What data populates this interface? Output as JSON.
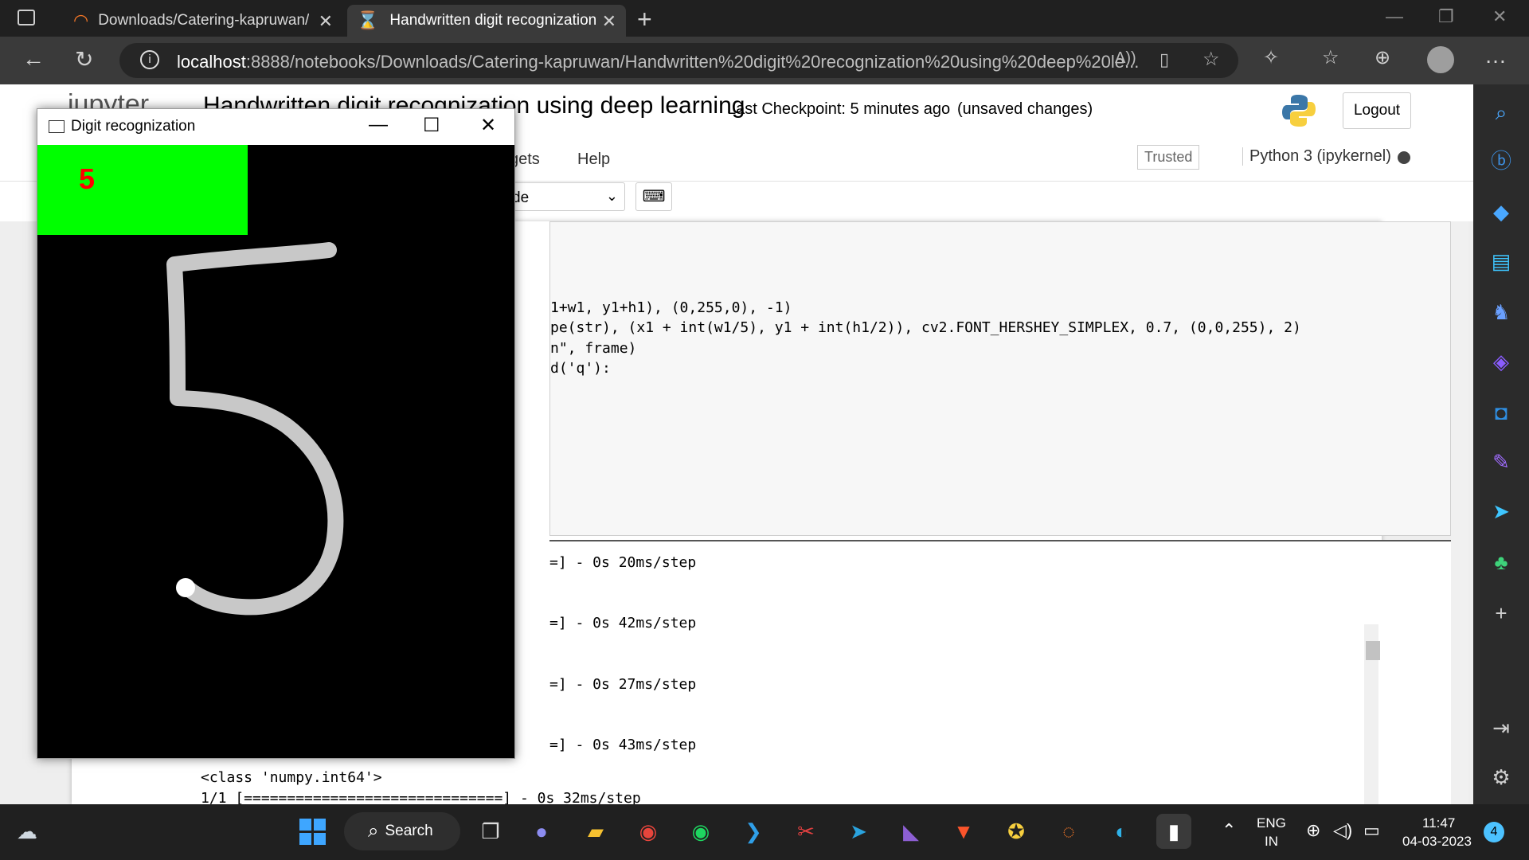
{
  "browser": {
    "tabs": [
      {
        "title": "Downloads/Catering-kapruwan/"
      },
      {
        "title": "Handwritten digit recognization u"
      }
    ],
    "url_host": "localhost",
    "url_rest": ":8888/notebooks/Downloads/Catering-kapruwan/Handwritten%20digit%20recognization%20using%20deep%20le..."
  },
  "jupyter": {
    "logo_text": "jupyter",
    "notebook_title": "Handwritten digit recognization using deep learning",
    "checkpoint": "Last Checkpoint: 5 minutes ago",
    "unsaved": "(unsaved changes)",
    "logout": "Logout",
    "menu_widgets_partial": "gets",
    "menu_help": "Help",
    "trusted": "Trusted",
    "kernel": "Python 3 (ipykernel)",
    "cell_type_partial": "de",
    "code_lines": [
      "1+w1, y1+h1), (0,255,0), -1)",
      "pe(str), (x1 + int(w1/5), y1 + int(h1/2)), cv2.FONT_HERSHEY_SIMPLEX, 0.7, (0,0,255), 2)",
      "n\", frame)",
      "d('q'):"
    ],
    "output_lines": [
      "=] - 0s 20ms/step",
      "=] - 0s 42ms/step",
      "=] - 0s 27ms/step",
      "=] - 0s 43ms/step"
    ],
    "class_line": "<class 'numpy.int64'>",
    "progress_line": "1/1 [==============================] - 0s 32ms/step"
  },
  "cv_window": {
    "title": "Digit recognization",
    "prediction": "5"
  },
  "taskbar": {
    "search": "Search",
    "lang_line1": "ENG",
    "lang_line2": "IN",
    "time": "11:47",
    "date": "04-03-2023",
    "notifications": "4"
  },
  "icons": [
    "edge-tab-icon",
    "jupyter-icon",
    "refresh-icon",
    "back-icon",
    "info-icon",
    "read-aloud-icon",
    "favorites-icon",
    "extensions-icon",
    "collections-icon",
    "profile-icon",
    "more-icon",
    "search-icon",
    "bing-icon",
    "shopping-icon",
    "tools-icon",
    "games-icon",
    "office-icon",
    "outlook-icon",
    "drop-icon",
    "add-icon",
    "settings-icon",
    "windows-start-icon",
    "python-logo"
  ]
}
